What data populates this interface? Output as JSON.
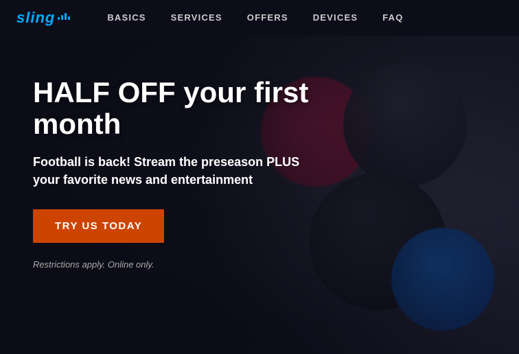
{
  "navbar": {
    "logo_text": "sling",
    "nav_items": [
      {
        "label": "BASICS",
        "href": "#"
      },
      {
        "label": "SERVICES",
        "href": "#"
      },
      {
        "label": "OFFERS",
        "href": "#"
      },
      {
        "label": "DEVICES",
        "href": "#"
      },
      {
        "label": "FAQ",
        "href": "#"
      }
    ]
  },
  "hero": {
    "title": "HALF OFF your first month",
    "subtitle": "Football is back! Stream the preseason PLUS your favorite news and entertainment",
    "cta_label": "TRY US TODAY",
    "restrictions_text": "Restrictions apply. Online only."
  },
  "colors": {
    "logo": "#1fbfff",
    "nav_bg": "#0d0d1a",
    "cta_bg": "#cc4400",
    "hero_bg": "#1a1a2a"
  }
}
